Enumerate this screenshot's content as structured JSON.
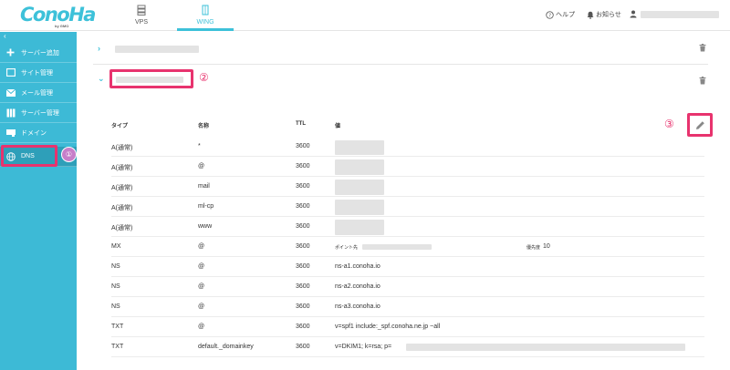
{
  "header": {
    "logo_main": "ConoHa",
    "logo_sub": "by GMO",
    "tabs": [
      {
        "label": "VPS",
        "active": false
      },
      {
        "label": "WING",
        "active": true
      }
    ],
    "help_label": "ヘルプ",
    "notice_label": "お知らせ"
  },
  "sidebar": {
    "collapse_icon": "‹",
    "items": [
      {
        "label": "サーバー追加",
        "icon": "plus-icon"
      },
      {
        "label": "サイト管理",
        "icon": "site-icon"
      },
      {
        "label": "メール管理",
        "icon": "mail-icon"
      },
      {
        "label": "サーバー管理",
        "icon": "server-icon"
      },
      {
        "label": "ドメイン",
        "icon": "domain-icon"
      },
      {
        "label": "DNS",
        "icon": "globe-icon",
        "active": true
      }
    ],
    "badge_label": "①"
  },
  "annotations": {
    "step2": "②",
    "step3": "③"
  },
  "table": {
    "columns": [
      "タイプ",
      "名称",
      "TTL",
      "値"
    ],
    "rows": [
      {
        "type": "A(通常)",
        "name": "*",
        "ttl": "3600",
        "value": ""
      },
      {
        "type": "A(通常)",
        "name": "@",
        "ttl": "3600",
        "value": ""
      },
      {
        "type": "A(通常)",
        "name": "mail",
        "ttl": "3600",
        "value": ""
      },
      {
        "type": "A(通常)",
        "name": "ml-cp",
        "ttl": "3600",
        "value": ""
      },
      {
        "type": "A(通常)",
        "name": "www",
        "ttl": "3600",
        "value": ""
      },
      {
        "type": "MX",
        "name": "@",
        "ttl": "3600",
        "value": "ポイント先",
        "priority_label": "優先度",
        "priority": "10"
      },
      {
        "type": "NS",
        "name": "@",
        "ttl": "3600",
        "value": "ns-a1.conoha.io"
      },
      {
        "type": "NS",
        "name": "@",
        "ttl": "3600",
        "value": "ns-a2.conoha.io"
      },
      {
        "type": "NS",
        "name": "@",
        "ttl": "3600",
        "value": "ns-a3.conoha.io"
      },
      {
        "type": "TXT",
        "name": "@",
        "ttl": "3600",
        "value": "v=spf1 include:_spf.conoha.ne.jp ~all"
      },
      {
        "type": "TXT",
        "name": "default._domainkey",
        "ttl": "3600",
        "value": "v=DKIM1; k=rsa; p="
      }
    ]
  },
  "colors": {
    "brand": "#3dc1d9",
    "sidebar": "#3dbad6",
    "highlight": "#e8336e"
  }
}
